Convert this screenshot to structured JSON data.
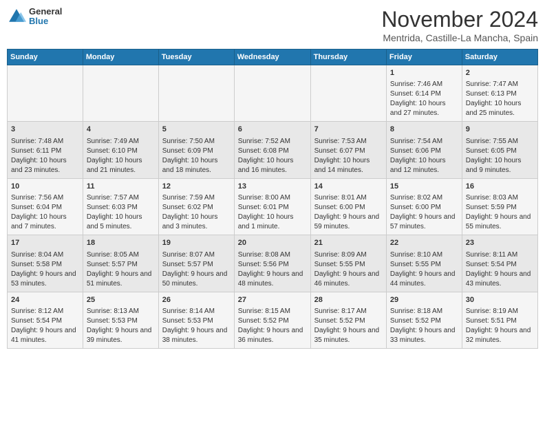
{
  "logo": {
    "general": "General",
    "blue": "Blue"
  },
  "header": {
    "month": "November 2024",
    "location": "Mentrida, Castille-La Mancha, Spain"
  },
  "days_of_week": [
    "Sunday",
    "Monday",
    "Tuesday",
    "Wednesday",
    "Thursday",
    "Friday",
    "Saturday"
  ],
  "weeks": [
    [
      {
        "day": "",
        "info": ""
      },
      {
        "day": "",
        "info": ""
      },
      {
        "day": "",
        "info": ""
      },
      {
        "day": "",
        "info": ""
      },
      {
        "day": "",
        "info": ""
      },
      {
        "day": "1",
        "info": "Sunrise: 7:46 AM\nSunset: 6:14 PM\nDaylight: 10 hours and 27 minutes."
      },
      {
        "day": "2",
        "info": "Sunrise: 7:47 AM\nSunset: 6:13 PM\nDaylight: 10 hours and 25 minutes."
      }
    ],
    [
      {
        "day": "3",
        "info": "Sunrise: 7:48 AM\nSunset: 6:11 PM\nDaylight: 10 hours and 23 minutes."
      },
      {
        "day": "4",
        "info": "Sunrise: 7:49 AM\nSunset: 6:10 PM\nDaylight: 10 hours and 21 minutes."
      },
      {
        "day": "5",
        "info": "Sunrise: 7:50 AM\nSunset: 6:09 PM\nDaylight: 10 hours and 18 minutes."
      },
      {
        "day": "6",
        "info": "Sunrise: 7:52 AM\nSunset: 6:08 PM\nDaylight: 10 hours and 16 minutes."
      },
      {
        "day": "7",
        "info": "Sunrise: 7:53 AM\nSunset: 6:07 PM\nDaylight: 10 hours and 14 minutes."
      },
      {
        "day": "8",
        "info": "Sunrise: 7:54 AM\nSunset: 6:06 PM\nDaylight: 10 hours and 12 minutes."
      },
      {
        "day": "9",
        "info": "Sunrise: 7:55 AM\nSunset: 6:05 PM\nDaylight: 10 hours and 9 minutes."
      }
    ],
    [
      {
        "day": "10",
        "info": "Sunrise: 7:56 AM\nSunset: 6:04 PM\nDaylight: 10 hours and 7 minutes."
      },
      {
        "day": "11",
        "info": "Sunrise: 7:57 AM\nSunset: 6:03 PM\nDaylight: 10 hours and 5 minutes."
      },
      {
        "day": "12",
        "info": "Sunrise: 7:59 AM\nSunset: 6:02 PM\nDaylight: 10 hours and 3 minutes."
      },
      {
        "day": "13",
        "info": "Sunrise: 8:00 AM\nSunset: 6:01 PM\nDaylight: 10 hours and 1 minute."
      },
      {
        "day": "14",
        "info": "Sunrise: 8:01 AM\nSunset: 6:00 PM\nDaylight: 9 hours and 59 minutes."
      },
      {
        "day": "15",
        "info": "Sunrise: 8:02 AM\nSunset: 6:00 PM\nDaylight: 9 hours and 57 minutes."
      },
      {
        "day": "16",
        "info": "Sunrise: 8:03 AM\nSunset: 5:59 PM\nDaylight: 9 hours and 55 minutes."
      }
    ],
    [
      {
        "day": "17",
        "info": "Sunrise: 8:04 AM\nSunset: 5:58 PM\nDaylight: 9 hours and 53 minutes."
      },
      {
        "day": "18",
        "info": "Sunrise: 8:05 AM\nSunset: 5:57 PM\nDaylight: 9 hours and 51 minutes."
      },
      {
        "day": "19",
        "info": "Sunrise: 8:07 AM\nSunset: 5:57 PM\nDaylight: 9 hours and 50 minutes."
      },
      {
        "day": "20",
        "info": "Sunrise: 8:08 AM\nSunset: 5:56 PM\nDaylight: 9 hours and 48 minutes."
      },
      {
        "day": "21",
        "info": "Sunrise: 8:09 AM\nSunset: 5:55 PM\nDaylight: 9 hours and 46 minutes."
      },
      {
        "day": "22",
        "info": "Sunrise: 8:10 AM\nSunset: 5:55 PM\nDaylight: 9 hours and 44 minutes."
      },
      {
        "day": "23",
        "info": "Sunrise: 8:11 AM\nSunset: 5:54 PM\nDaylight: 9 hours and 43 minutes."
      }
    ],
    [
      {
        "day": "24",
        "info": "Sunrise: 8:12 AM\nSunset: 5:54 PM\nDaylight: 9 hours and 41 minutes."
      },
      {
        "day": "25",
        "info": "Sunrise: 8:13 AM\nSunset: 5:53 PM\nDaylight: 9 hours and 39 minutes."
      },
      {
        "day": "26",
        "info": "Sunrise: 8:14 AM\nSunset: 5:53 PM\nDaylight: 9 hours and 38 minutes."
      },
      {
        "day": "27",
        "info": "Sunrise: 8:15 AM\nSunset: 5:52 PM\nDaylight: 9 hours and 36 minutes."
      },
      {
        "day": "28",
        "info": "Sunrise: 8:17 AM\nSunset: 5:52 PM\nDaylight: 9 hours and 35 minutes."
      },
      {
        "day": "29",
        "info": "Sunrise: 8:18 AM\nSunset: 5:52 PM\nDaylight: 9 hours and 33 minutes."
      },
      {
        "day": "30",
        "info": "Sunrise: 8:19 AM\nSunset: 5:51 PM\nDaylight: 9 hours and 32 minutes."
      }
    ]
  ]
}
